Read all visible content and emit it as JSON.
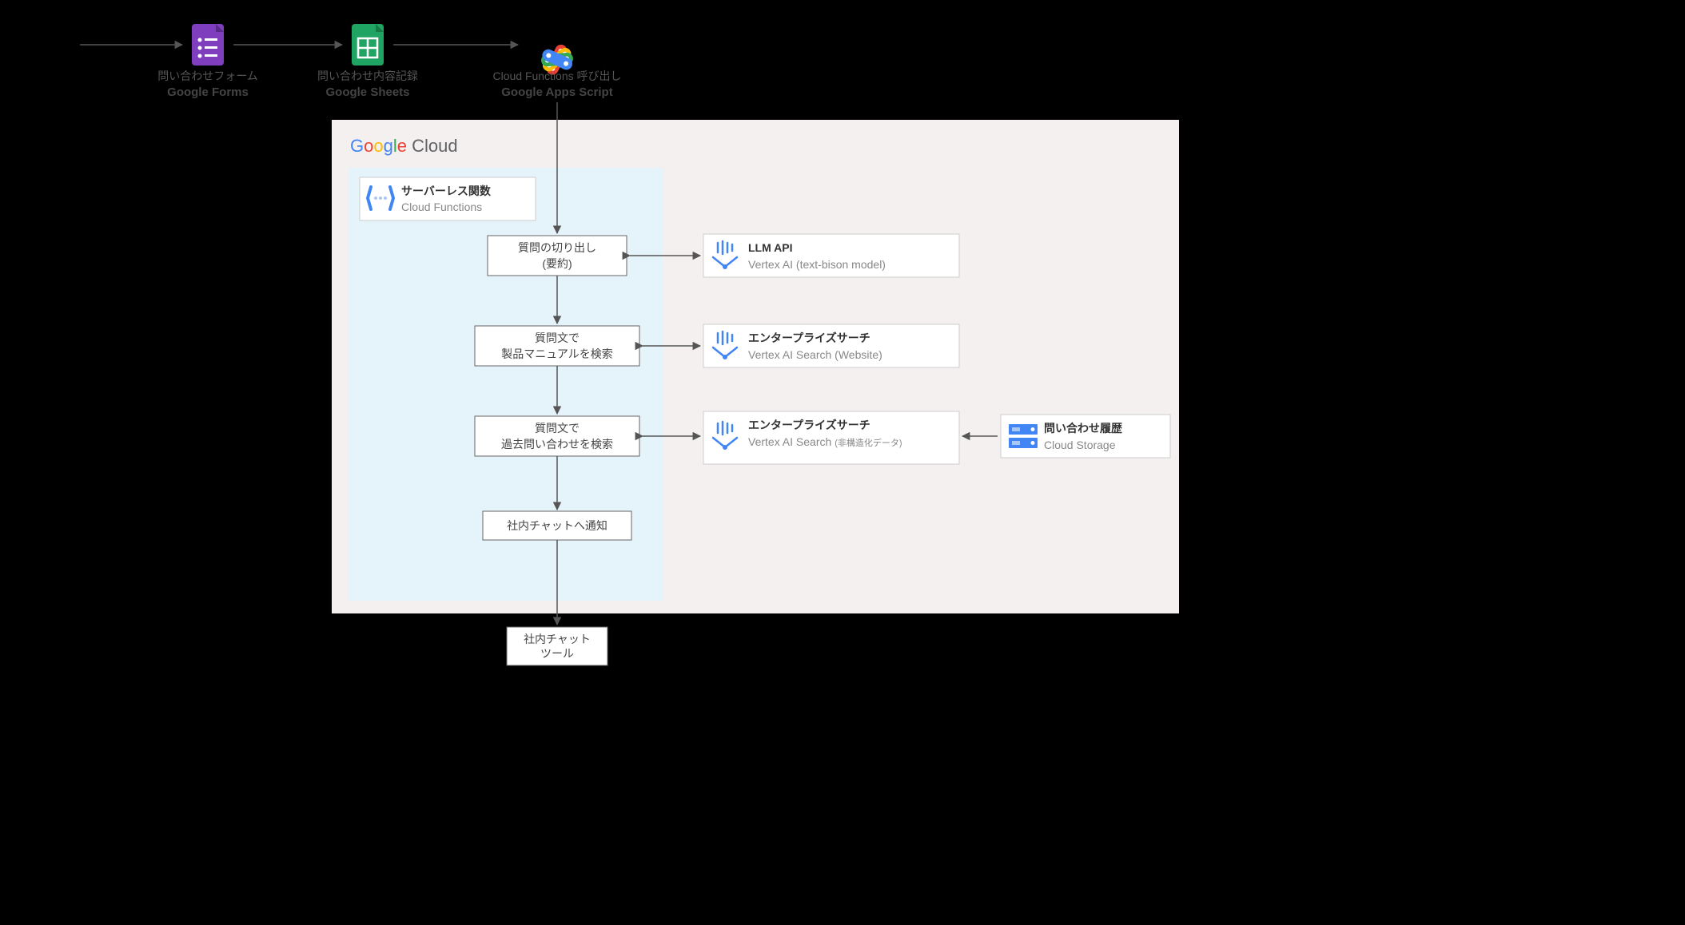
{
  "top": {
    "forms": {
      "line1": "問い合わせフォーム",
      "line2": "Google Forms"
    },
    "sheets": {
      "line1": "問い合わせ内容記録",
      "line2": "Google Sheets"
    },
    "gas": {
      "line1": "Cloud Functions 呼び出し",
      "line2": "Google Apps Script"
    }
  },
  "panel": {
    "googleCloud": "Cloud",
    "cloudFunctions": {
      "title": "サーバーレス関数",
      "sub": "Cloud Functions"
    }
  },
  "steps": {
    "s1a": "質問の切り出し",
    "s1b": "(要約)",
    "s2a": "質問文で",
    "s2b": "製品マニュアルを検索",
    "s3a": "質問文で",
    "s3b": "過去問い合わせを検索",
    "s4": "社内チャットへ通知",
    "out1": "社内チャット",
    "out2": "ツール"
  },
  "services": {
    "llm": {
      "title": "LLM API",
      "sub": "Vertex AI (text-bison model)"
    },
    "search1": {
      "title": "エンタープライズサーチ",
      "sub": "Vertex AI Search (Website)"
    },
    "search2": {
      "title": "エンタープライズサーチ",
      "sub1": "Vertex AI Search",
      "sub2": "(非構造化データ)"
    },
    "storage": {
      "title": "問い合わせ履歴",
      "sub": "Cloud Storage"
    }
  }
}
